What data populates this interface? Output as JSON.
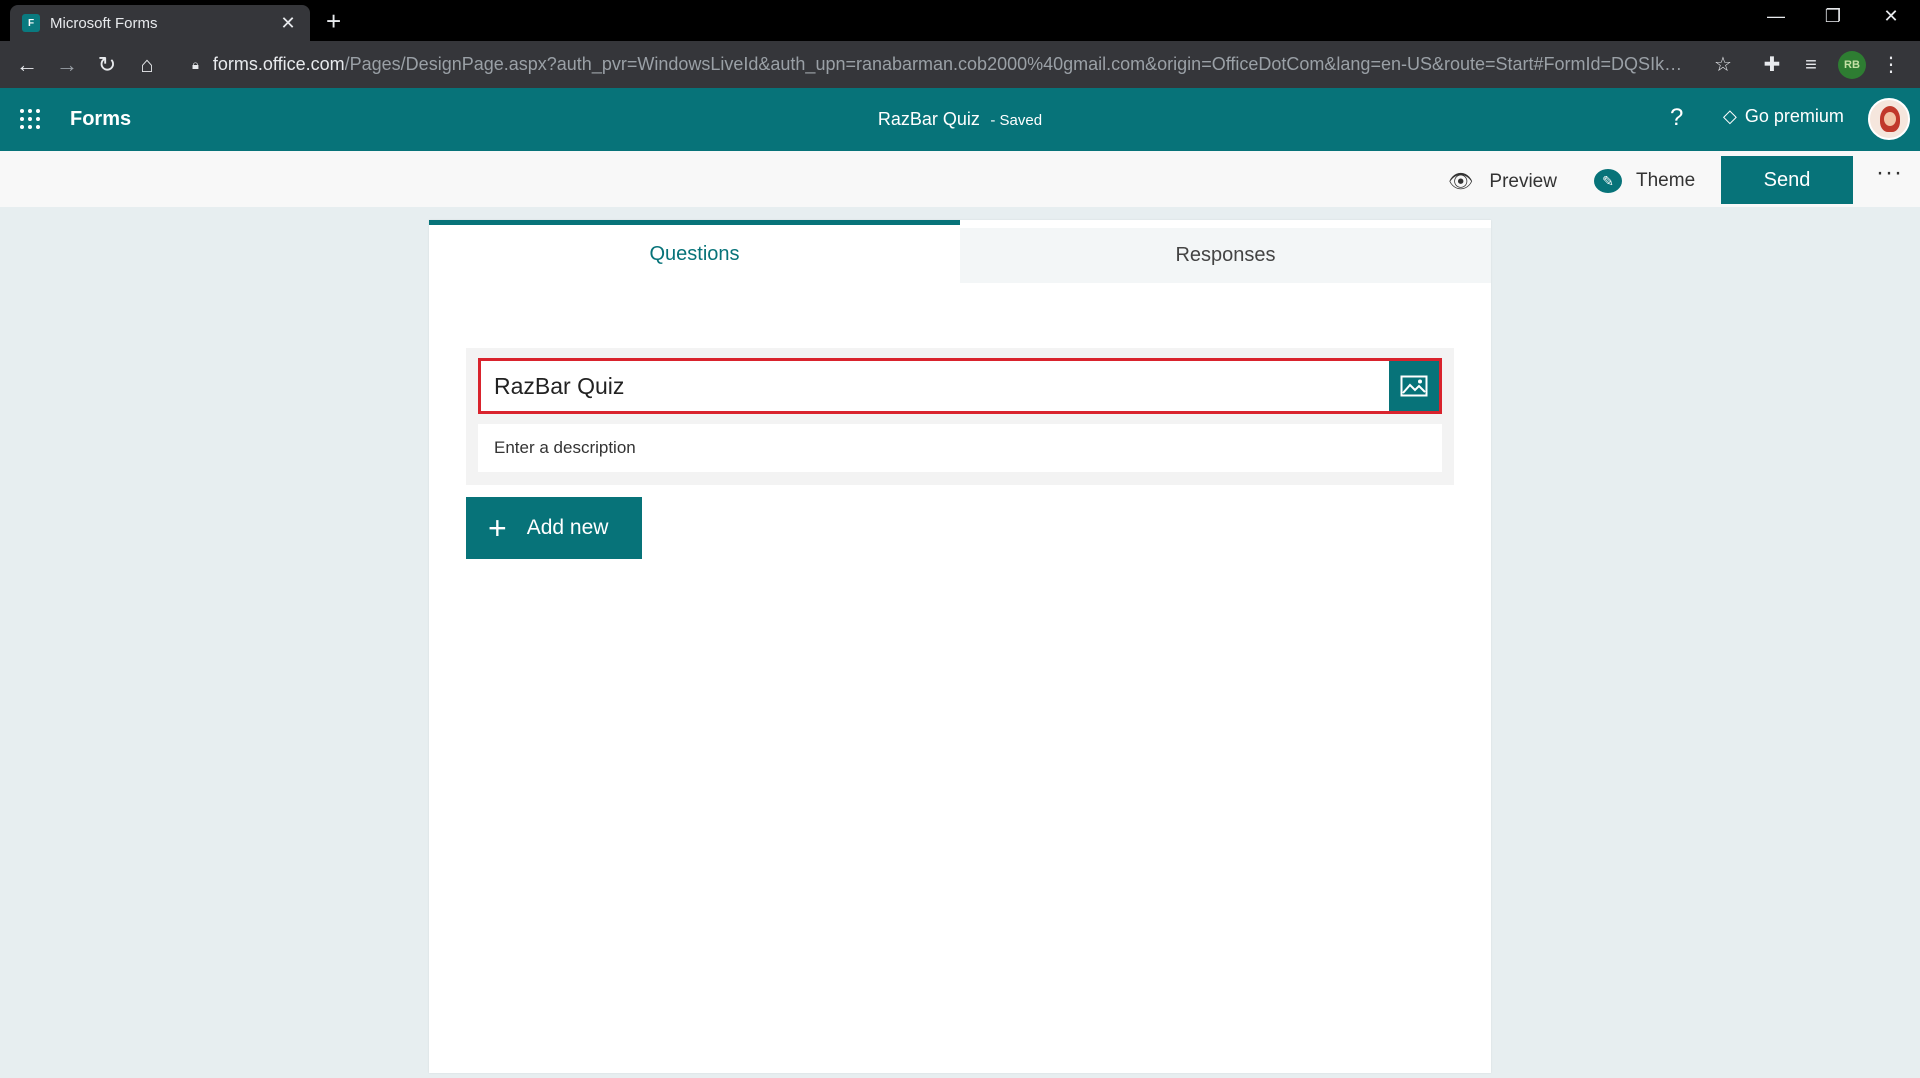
{
  "browser": {
    "tab_title": "Microsoft Forms",
    "tab_favicon": "F",
    "url_host": "forms.office.com",
    "url_rest": "/Pages/DesignPage.aspx?auth_pvr=WindowsLiveId&auth_upn=ranabarman.cob2000%40gmail.com&origin=OfficeDotCom&lang=en-US&route=Start#FormId=DQSIkWdsW...",
    "profile_badge": "RB"
  },
  "header": {
    "app_name": "Forms",
    "form_title": "RazBar Quiz",
    "saved_status": "- Saved",
    "help": "?",
    "premium_label": "Go premium"
  },
  "toolbar": {
    "preview_label": "Preview",
    "theme_label": "Theme",
    "send_label": "Send",
    "more_label": "···"
  },
  "tabs": {
    "questions": "Questions",
    "responses": "Responses"
  },
  "form": {
    "title_value": "RazBar Quiz",
    "description_placeholder": "Enter a description",
    "add_new_label": "Add new"
  },
  "colors": {
    "brand": "#077379",
    "focus_border": "#d9232d"
  }
}
